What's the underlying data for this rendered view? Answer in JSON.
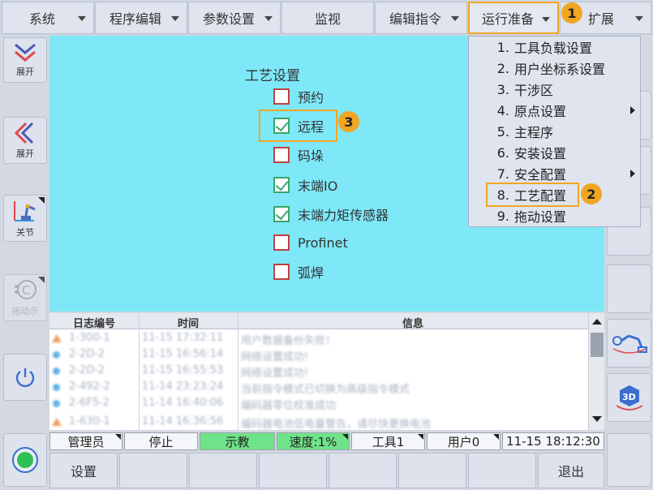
{
  "menu": {
    "items": [
      {
        "label": "系统"
      },
      {
        "label": "程序编辑"
      },
      {
        "label": "参数设置"
      },
      {
        "label": "监视"
      },
      {
        "label": "编辑指令"
      },
      {
        "label": "运行准备"
      },
      {
        "label": "扩展"
      }
    ]
  },
  "annotations": {
    "one": "1",
    "two": "2",
    "three": "3"
  },
  "left_sidebar": {
    "expand1": "展开",
    "expand2": "展开",
    "joint": "关节",
    "drag_demo": "拖动示"
  },
  "craft": {
    "title": "工艺设置",
    "options": [
      {
        "label": "预约",
        "checked": false
      },
      {
        "label": "远程",
        "checked": true
      },
      {
        "label": "码垛",
        "checked": false
      },
      {
        "label": "末端IO",
        "checked": true
      },
      {
        "label": "末端力矩传感器",
        "checked": true
      },
      {
        "label": "Profinet",
        "checked": false
      },
      {
        "label": "弧焊",
        "checked": false
      }
    ]
  },
  "dropdown": {
    "items": [
      {
        "num": "1.",
        "label": "工具负载设置"
      },
      {
        "num": "2.",
        "label": "用户坐标系设置"
      },
      {
        "num": "3.",
        "label": "干涉区"
      },
      {
        "num": "4.",
        "label": "原点设置"
      },
      {
        "num": "5.",
        "label": "主程序"
      },
      {
        "num": "6.",
        "label": "安装设置"
      },
      {
        "num": "7.",
        "label": "安全配置"
      },
      {
        "num": "8.",
        "label": "工艺配置"
      },
      {
        "num": "9.",
        "label": "拖动设置"
      }
    ]
  },
  "log": {
    "headers": {
      "id": "日志编号",
      "time": "时间",
      "info": "信息"
    },
    "rows": [
      {
        "id": "1-300-1",
        "time": "11-15 17:32:11",
        "info": "用户数据备份失败！",
        "kind": "warn"
      },
      {
        "id": "2-2D-2",
        "time": "11-15 16:56:14",
        "info": "网络设置成功!",
        "kind": "info"
      },
      {
        "id": "2-2D-2",
        "time": "11-15 16:55:53",
        "info": "网络设置成功!",
        "kind": "info"
      },
      {
        "id": "2-492-2",
        "time": "11-14 23:23:24",
        "info": "当前指令模式已切换为高级指令模式",
        "kind": "info"
      },
      {
        "id": "2-6F5-2",
        "time": "11-14 16:40:06",
        "info": "编码器零位校准成功",
        "kind": "info"
      },
      {
        "id": "1-630-1",
        "time": "11-14 16:36:56",
        "info": "编码器电池低电量警告，请尽快更换电池",
        "kind": "warn"
      }
    ]
  },
  "status": {
    "user": "管理员",
    "state": "停止",
    "mode": "示教",
    "speed": "速度:1%",
    "tool": "工具1",
    "user_frame": "用户0",
    "datetime": "11-15 18:12:30"
  },
  "bottom": {
    "settings": "设置",
    "exit": "退出"
  },
  "colors": {
    "accent": "#f0a623",
    "panel": "#7ee8f8",
    "status_green": "#6fe389"
  }
}
